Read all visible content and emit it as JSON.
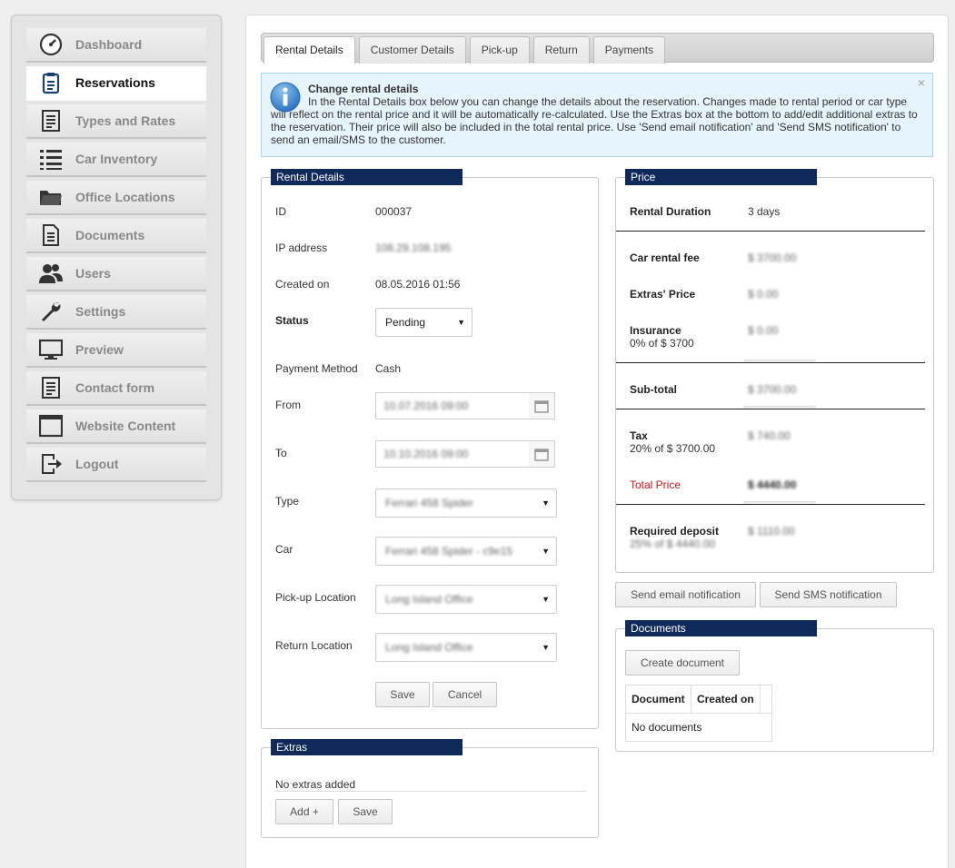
{
  "sidebar": {
    "items": [
      {
        "label": "Dashboard",
        "icon": "dashboard-gauge-icon"
      },
      {
        "label": "Reservations",
        "icon": "clipboard-icon"
      },
      {
        "label": "Types and Rates",
        "icon": "document-list-icon"
      },
      {
        "label": "Car Inventory",
        "icon": "list-icon"
      },
      {
        "label": "Office Locations",
        "icon": "folder-icon"
      },
      {
        "label": "Documents",
        "icon": "document-icon"
      },
      {
        "label": "Users",
        "icon": "users-icon"
      },
      {
        "label": "Settings",
        "icon": "wrench-icon"
      },
      {
        "label": "Preview",
        "icon": "monitor-icon"
      },
      {
        "label": "Contact form",
        "icon": "form-icon"
      },
      {
        "label": "Website Content",
        "icon": "window-icon"
      },
      {
        "label": "Logout",
        "icon": "logout-icon"
      }
    ],
    "active": "Reservations"
  },
  "tabs": [
    "Rental Details",
    "Customer Details",
    "Pick-up",
    "Return",
    "Payments"
  ],
  "info": {
    "title": "Change rental details",
    "text": "In the Rental Details box below you can change the details about the reservation. Changes made to rental period or car type will reflect on the rental price and it will be automatically re-calculated. Use the Extras box at the bottom to add/edit additional extras to the reservation. Their price will also be included in the total rental price. Use 'Send email notification' and 'Send SMS notification' to send an email/SMS to the customer.",
    "close": "×"
  },
  "rental": {
    "title": "Rental Details",
    "id_label": "ID",
    "id_value": "000037",
    "ip_label": "IP address",
    "ip_value": "108.29.108.195",
    "created_label": "Created on",
    "created_value": "08.05.2016 01:56",
    "status_label": "Status",
    "status_value": "Pending",
    "payment_label": "Payment Method",
    "payment_value": "Cash",
    "from_label": "From",
    "from_value": "10.07.2016 09:00",
    "to_label": "To",
    "to_value": "10.10.2016 09:00",
    "type_label": "Type",
    "type_value": "Ferrari 458 Spider",
    "car_label": "Car",
    "car_value": "Ferrari 458 Spider - c9e15",
    "pickup_label": "Pick-up Location",
    "pickup_value": "Long Island Office",
    "return_label": "Return Location",
    "return_value": "Long Island Office",
    "save": "Save",
    "cancel": "Cancel"
  },
  "extras": {
    "title": "Extras",
    "empty": "No extras added",
    "add": "Add +",
    "save": "Save"
  },
  "price": {
    "title": "Price",
    "duration_label": "Rental Duration",
    "duration_value": "3 days",
    "fee_label": "Car rental fee",
    "fee_value": "$ 3700.00",
    "extras_label": "Extras' Price",
    "extras_value": "$ 0.00",
    "insurance_label": "Insurance",
    "insurance_sub": "0% of $ 3700",
    "insurance_value": "$ 0.00",
    "subtotal_label": "Sub-total",
    "subtotal_value": "$ 3700.00",
    "tax_label": "Tax",
    "tax_sub": "20% of $ 3700.00",
    "tax_value": "$ 740.00",
    "total_label": "Total Price",
    "total_value": "$ 4440.00",
    "deposit_label": "Required deposit",
    "deposit_sub": "25% of $ 4440.00",
    "deposit_value": "$ 1110.00",
    "total_color": "#d0141c"
  },
  "notify": {
    "email": "Send email notification",
    "sms": "Send SMS notification"
  },
  "documents": {
    "title": "Documents",
    "create": "Create document",
    "col_document": "Document",
    "col_created": "Created on",
    "empty": "No documents"
  }
}
